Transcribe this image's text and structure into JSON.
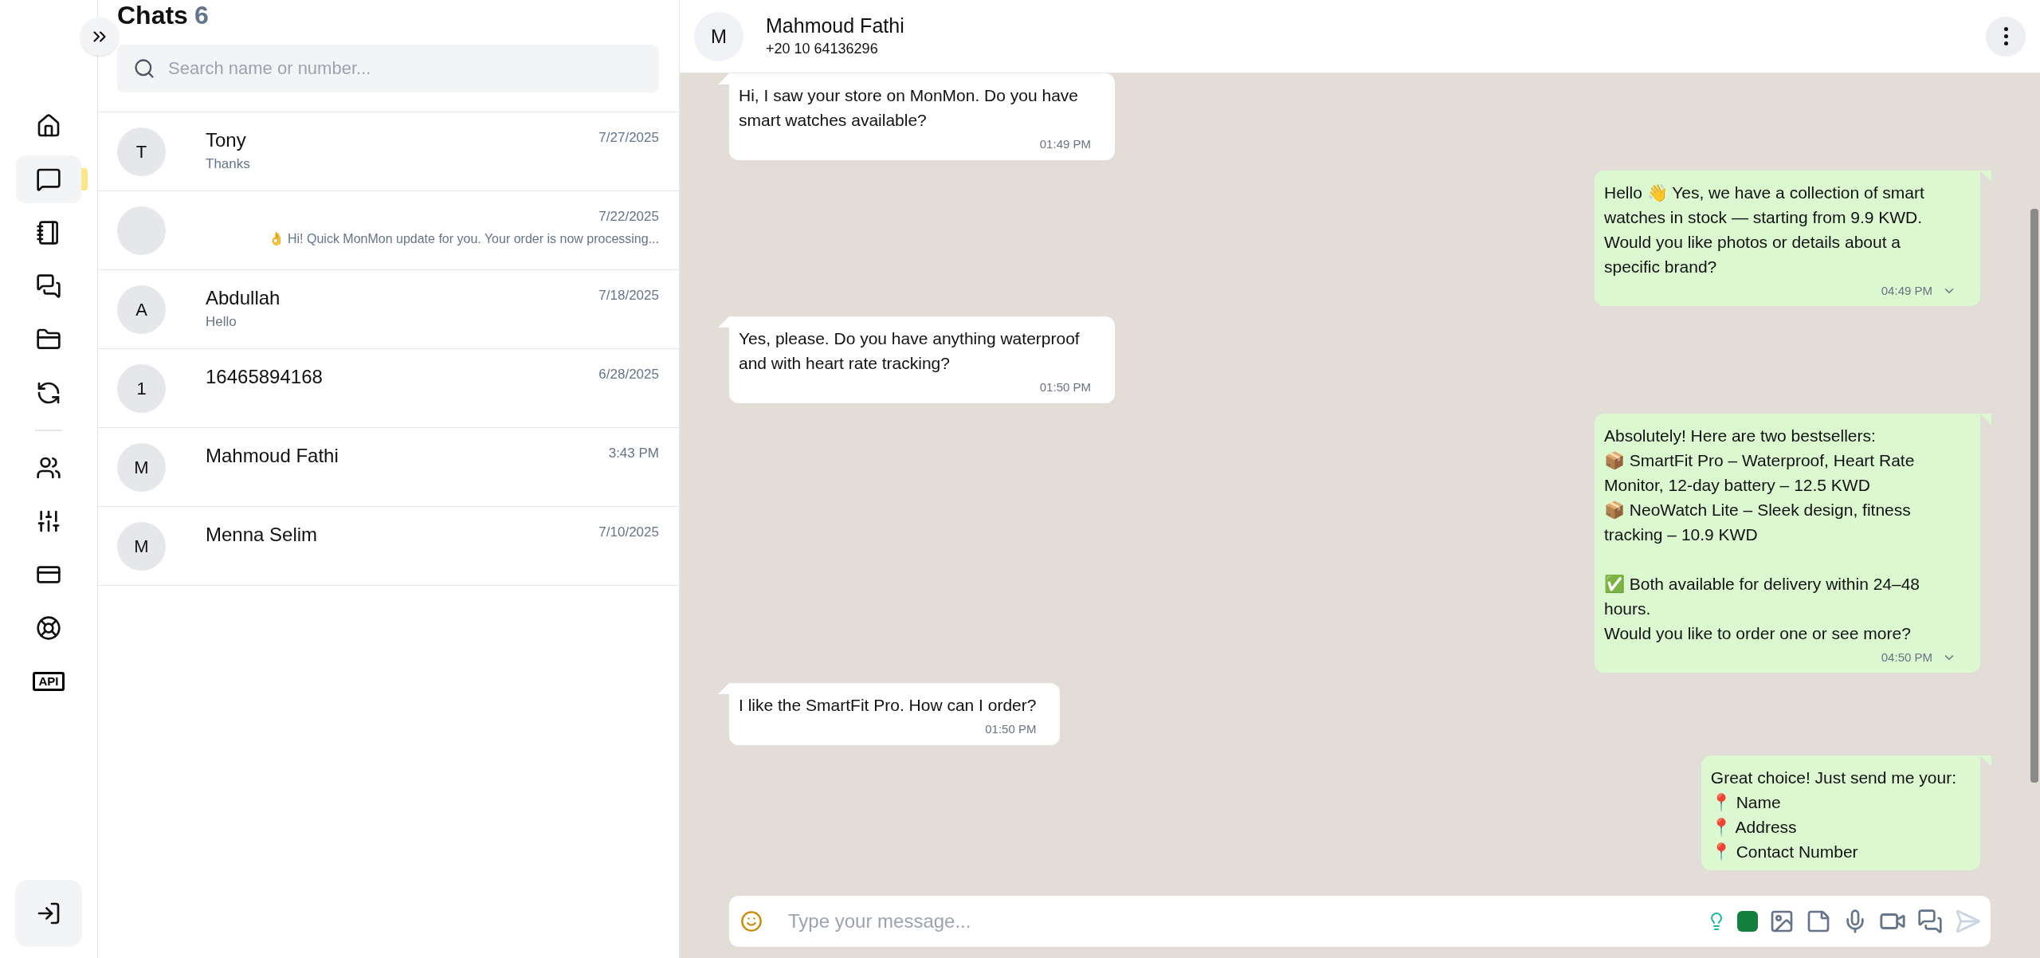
{
  "nav": {
    "items": [
      {
        "selected": false
      },
      {
        "selected": true
      },
      {
        "selected": false
      },
      {
        "selected": false
      },
      {
        "selected": false
      },
      {
        "selected": false
      },
      {
        "selected": false
      },
      {
        "selected": false
      },
      {
        "selected": false
      },
      {
        "selected": false
      },
      {
        "selected": false,
        "label": "API"
      }
    ]
  },
  "chat_list": {
    "title": "Chats",
    "count": "6",
    "search": {
      "placeholder": "Search name or number..."
    },
    "chats": [
      {
        "initial": "T",
        "name": "Tony",
        "preview": "Thanks",
        "date": "7/27/2025"
      },
      {
        "preview": "👌 Hi! Quick MonMon update for you. Your order is now processing...",
        "date": "7/22/2025"
      },
      {
        "initial": "A",
        "name": "Abdullah",
        "preview": "Hello",
        "date": "7/18/2025"
      },
      {
        "initial": "1",
        "name": "16465894168",
        "date": "6/28/2025"
      },
      {
        "initial": "M",
        "name": "Mahmoud Fathi",
        "date": "3:43 PM"
      },
      {
        "initial": "M",
        "name": "Menna Selim",
        "date": "7/10/2025"
      }
    ]
  },
  "conversation": {
    "contact": {
      "initial": "M",
      "name": "Mahmoud Fathi",
      "phone": "+20 10 64136296"
    },
    "messages": [
      {
        "kind": "incoming",
        "text": "Hi, I saw your store on MonMon. Do you have smart watches available?",
        "time": "01:49 PM"
      },
      {
        "kind": "outgoing",
        "text": "Hello 👋 Yes, we have a collection of smart watches in stock — starting from 9.9 KWD. Would you like photos or details about a specific brand?",
        "time": "04:49 PM"
      },
      {
        "kind": "incoming",
        "text": "Yes, please. Do you have anything waterproof and with heart rate tracking?",
        "time": "01:50 PM"
      },
      {
        "kind": "outgoing",
        "text": "Absolutely! Here are two bestsellers:\n📦 SmartFit Pro – Waterproof, Heart Rate Monitor, 12-day battery – 12.5 KWD\n📦 NeoWatch Lite – Sleek design, fitness tracking – 10.9 KWD\n\n✅ Both available for delivery within 24–48 hours.\nWould you like to order one or see more?",
        "time": "04:50 PM"
      },
      {
        "kind": "incoming",
        "text": "I like the SmartFit Pro. How can I order?",
        "time": "01:50 PM"
      },
      {
        "kind": "outgoing",
        "text": "Great choice! Just send me your:\n📍 Name\n📍 Address\n📍 Contact Number"
      }
    ],
    "composer": {
      "placeholder": "Type your message..."
    }
  }
}
